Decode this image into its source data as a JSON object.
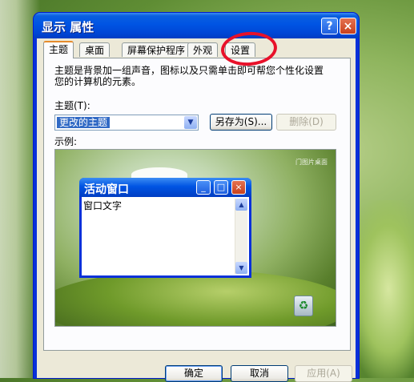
{
  "window": {
    "title": "显示 属性",
    "help_label": "?",
    "close_label": "×"
  },
  "tabs": [
    {
      "label": "主题",
      "active": true
    },
    {
      "label": "桌面",
      "active": false
    },
    {
      "label": "屏幕保护程序",
      "active": false
    },
    {
      "label": "外观",
      "active": false
    },
    {
      "label": "设置",
      "active": false
    }
  ],
  "theme_page": {
    "description_line1": "主题是背景加一组声音，图标以及只需单击即可帮您个性化设置",
    "description_line2": "您的计算机的元素。",
    "theme_label": "主题(T):",
    "theme_value": "更改的主题",
    "save_as_label": "另存为(S)...",
    "delete_label": "删除(D)",
    "sample_label": "示例:"
  },
  "preview": {
    "brand_text": "门图片桌面",
    "mini_window": {
      "title": "活动窗口",
      "body_text": "窗口文字",
      "min": "_",
      "max": "□",
      "close": "×"
    }
  },
  "footer": {
    "ok_label": "确定",
    "cancel_label": "取消",
    "apply_label": "应用(A)"
  },
  "colors": {
    "titlebar": "#0054e3",
    "annotation": "#e8112a",
    "tab_highlight": "#e68b2c"
  },
  "icons": [
    "help-icon",
    "close-icon",
    "dropdown-arrow-icon",
    "recycle-bin-icon",
    "scroll-up-icon",
    "scroll-down-icon"
  ]
}
